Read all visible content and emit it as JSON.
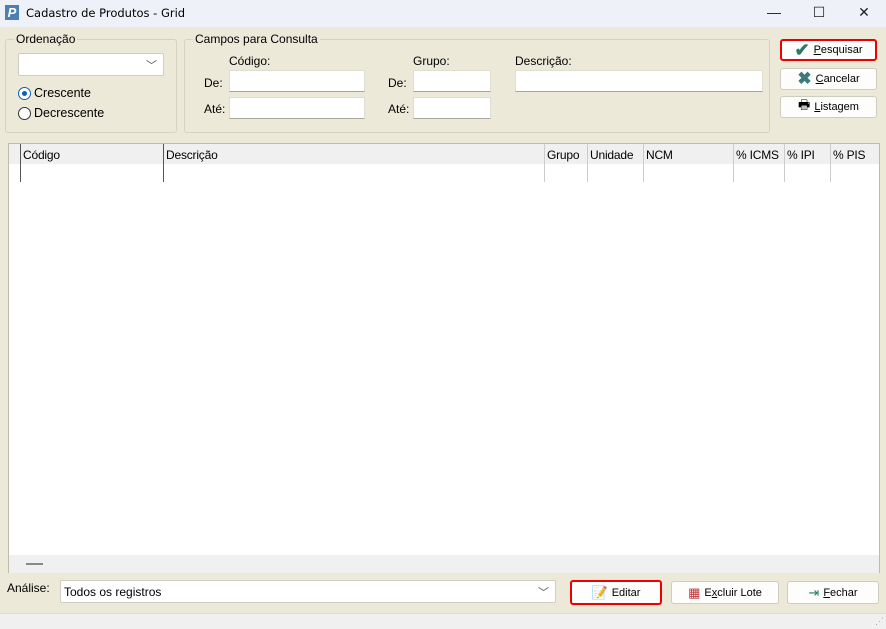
{
  "window": {
    "title": "Cadastro de Produtos - Grid",
    "logo": "P",
    "minimize": "—",
    "maximize": "☐",
    "close": "✕"
  },
  "ordenacao": {
    "legend": "Ordenação",
    "combo_value": "",
    "options": [
      {
        "label": "Crescente",
        "selected": true
      },
      {
        "label": "Decrescente",
        "selected": false
      }
    ]
  },
  "campos": {
    "legend": "Campos para Consulta",
    "codigo_label": "Código:",
    "grupo_label": "Grupo:",
    "descricao_label": "Descrição:",
    "de": "De:",
    "ate": "Até:",
    "codigo_de": "",
    "codigo_ate": "",
    "grupo_de": "",
    "grupo_ate": "",
    "descricao": ""
  },
  "buttons": {
    "pesquisar": "esquisar",
    "pesquisar_key": "P",
    "cancelar": "ancelar",
    "cancelar_key": "C",
    "listagem": "istagem",
    "listagem_key": "L",
    "editar": "Editar",
    "excluir_key": "x",
    "excluir_pre": "E",
    "excluir_post": "cluir Lote",
    "fechar_key": "F",
    "fechar": "echar"
  },
  "grid": {
    "columns": [
      "Código",
      "Descrição",
      "Grupo",
      "Unidade",
      "NCM",
      "% ICMS",
      "% IPI",
      "% PIS"
    ],
    "rows": []
  },
  "analise": {
    "label": "Análise:",
    "value": "Todos os registros"
  },
  "colors": {
    "highlight": "#ee0000",
    "background": "#ece9d9",
    "accent": "#0a5fb4"
  }
}
